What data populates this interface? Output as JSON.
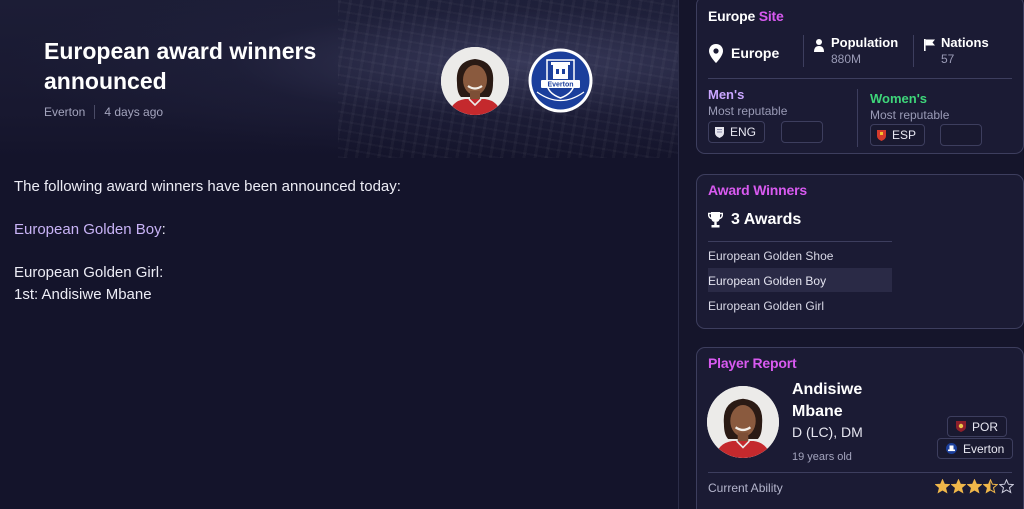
{
  "article": {
    "title": "European award winners announced",
    "source": "Everton",
    "time_ago": "4 days ago",
    "body": {
      "intro": "The following award winners have been announced today:",
      "golden_boy_link": "European Golden Boy",
      "golden_boy_colon": ":",
      "golden_girl_heading": "European Golden Girl:",
      "golden_girl_winner": "1st: Andisiwe Mbane"
    }
  },
  "europe_site": {
    "title_prefix": "Europe",
    "title_suffix": "Site",
    "region": "Europe",
    "population_label": "Population",
    "population_value": "880M",
    "nations_label": "Nations",
    "nations_value": "57",
    "mens_title": "Men's",
    "mens_sub": "Most reputable",
    "mens_nation": "ENG",
    "womens_title": "Women's",
    "womens_sub": "Most reputable",
    "womens_nation": "ESP",
    "colors": {
      "mens": "#c9a6ff",
      "womens": "#3ed67a"
    }
  },
  "award_winners": {
    "title": "Award Winners",
    "count_label": "3 Awards",
    "items": [
      {
        "label": "European Golden Shoe",
        "selected": false
      },
      {
        "label": "European Golden Boy",
        "selected": true
      },
      {
        "label": "European Golden Girl",
        "selected": false
      }
    ]
  },
  "player_report": {
    "title": "Player Report",
    "first_name": "Andisiwe",
    "last_name": "Mbane",
    "positions": "D (LC), DM",
    "age": "19 years old",
    "nation": "POR",
    "club": "Everton",
    "ability_label": "Current Ability",
    "ability_stars": 3.5,
    "ability_max": 5
  },
  "icons": {
    "location": "map-pin-icon",
    "population": "person-icon",
    "nations": "flag-icon",
    "trophy": "trophy-icon",
    "accent": "#d85af0"
  }
}
